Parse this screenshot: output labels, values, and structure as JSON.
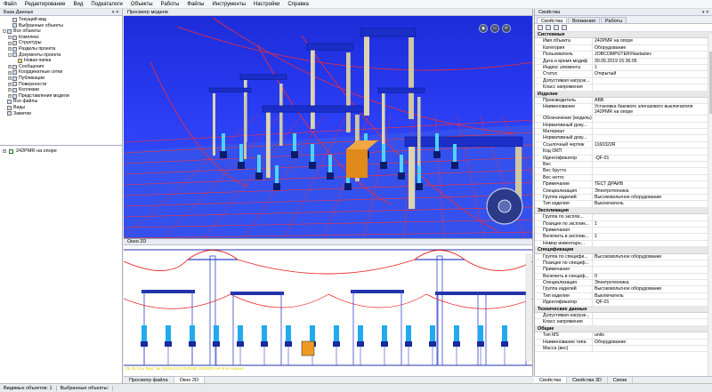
{
  "menu": [
    "Файл",
    "Редактирование",
    "Вид",
    "Подкаталоги",
    "Объекты",
    "Работы",
    "Файлы",
    "Инструменты",
    "Настройки",
    "Справка"
  ],
  "left_panel": {
    "title": "База Данных",
    "tree": [
      {
        "label": "Текущий вид",
        "indent": 1,
        "exp": ""
      },
      {
        "label": "Выбранные объекты",
        "indent": 1,
        "exp": ""
      },
      {
        "label": "Все объекты",
        "indent": 0,
        "exp": "-"
      },
      {
        "label": "Комплекс",
        "indent": 1,
        "exp": "+"
      },
      {
        "label": "Структуры",
        "indent": 1,
        "exp": "+"
      },
      {
        "label": "Разделы проекта",
        "indent": 1,
        "exp": "+"
      },
      {
        "label": "Документы проекта",
        "indent": 1,
        "exp": "-"
      },
      {
        "label": "Новая папка",
        "indent": 2,
        "exp": ""
      },
      {
        "label": "Сообщения",
        "indent": 1,
        "exp": "+"
      },
      {
        "label": "Координатные сетки",
        "indent": 1,
        "exp": "+"
      },
      {
        "label": "Публикации",
        "indent": 1,
        "exp": "+"
      },
      {
        "label": "Поверхности",
        "indent": 1,
        "exp": "+"
      },
      {
        "label": "Коллизии",
        "indent": 1,
        "exp": "+"
      },
      {
        "label": "Представления модели",
        "indent": 1,
        "exp": "+"
      },
      {
        "label": "Все файлы",
        "indent": 0,
        "exp": ""
      },
      {
        "label": "Виды",
        "indent": 0,
        "exp": ""
      },
      {
        "label": "Заметки",
        "indent": 0,
        "exp": ""
      }
    ],
    "layer_item": "242PMR на опоре"
  },
  "viewport": {
    "title": "Просмотр модели",
    "tool_icons": [
      "camera-icon",
      "ortho-icon",
      "rotate-icon"
    ]
  },
  "window2d": {
    "title": "Окно 2D",
    "status_text": "Z5.33 Ось Ярус 3м 1100х1100 1000000 1000000 На 9mm.каркас"
  },
  "bottom_tabs": {
    "left": [
      "Просмотр файла",
      "Окно 2D"
    ],
    "right": [
      "Свойства",
      "Свойства 3D",
      "Связи"
    ]
  },
  "properties": {
    "title": "Свойства",
    "tabs": [
      "Свойства",
      "Вложения",
      "Работы"
    ],
    "groups": [
      {
        "name": "Системные",
        "rows": [
          [
            "Имя объекта",
            "242PMR на опоре"
          ],
          [
            "Категория",
            "Оборудование"
          ],
          [
            "Пользователь",
            "JOBCOMPUTER\\Nastaziev"
          ],
          [
            "Дата и время модиф",
            "30.05.2019 15:36:05"
          ],
          [
            "Индекс элемента",
            "1"
          ],
          [
            "Статус",
            "Открытый"
          ],
          [
            "Допустимая нагрузк...",
            ""
          ],
          [
            "Класс напряжения",
            ""
          ]
        ]
      },
      {
        "name": "Изделие",
        "rows": [
          [
            "Производитель",
            "ABB"
          ],
          [
            "Наименование",
            "Установка бакового элегазового выключателя 242PMR на опоре",
            true
          ],
          [
            "Обозначение (модель)",
            ""
          ],
          [
            "Нормативный доку...",
            ""
          ],
          [
            "Материал",
            ""
          ],
          [
            "Нормативный доку...",
            ""
          ],
          [
            "Ссылочный чертеж",
            "1160322R"
          ],
          [
            "Код ОКП",
            ""
          ],
          [
            "Идентификатор",
            "-QF-01"
          ],
          [
            "Вес",
            ""
          ],
          [
            "Вес брутто",
            ""
          ],
          [
            "Вес нетто",
            ""
          ],
          [
            "Примечание",
            "ТЕСТ ДРАЙВ"
          ],
          [
            "Специализация",
            "Электротехника"
          ],
          [
            "Группа изделий",
            "Высоковольтное оборудование"
          ],
          [
            "Тип изделия",
            "Выключатель"
          ]
        ]
      },
      {
        "name": "Экспликация",
        "rows": [
          [
            "Группа по экспли...",
            ""
          ],
          [
            "Позиция по эксплик...",
            "1"
          ],
          [
            "Примечания",
            ""
          ],
          [
            "Включить в эксплик...",
            "1"
          ],
          [
            "Номер инвентарн...",
            ""
          ]
        ]
      },
      {
        "name": "Спецификация",
        "rows": [
          [
            "Группа по специфи...",
            "Высоковольтное оборудование"
          ],
          [
            "Позиция по специф...",
            ""
          ],
          [
            "Примечания",
            ""
          ],
          [
            "Включить в специф...",
            "0"
          ],
          [
            "Специализация",
            "Электротехника"
          ],
          [
            "Группа изделий",
            "Высоковольтное оборудование"
          ],
          [
            "Тип изделия",
            "Выключатель"
          ],
          [
            "Идентификатор",
            "-QF-01"
          ]
        ]
      },
      {
        "name": "Технические данные",
        "rows": [
          [
            "Допустимая нагрузк...",
            ""
          ],
          [
            "Класс напряжения",
            ""
          ]
        ]
      },
      {
        "name": "Общие",
        "rows": [
          [
            "Тип MS",
            "units"
          ],
          [
            "Наименование типа",
            "Оборудование"
          ],
          [
            "Масса (вес)",
            ""
          ]
        ]
      }
    ]
  },
  "statusbar": {
    "visible": "Видимых объектов: 1",
    "selected": "Выбранные объекты:"
  }
}
